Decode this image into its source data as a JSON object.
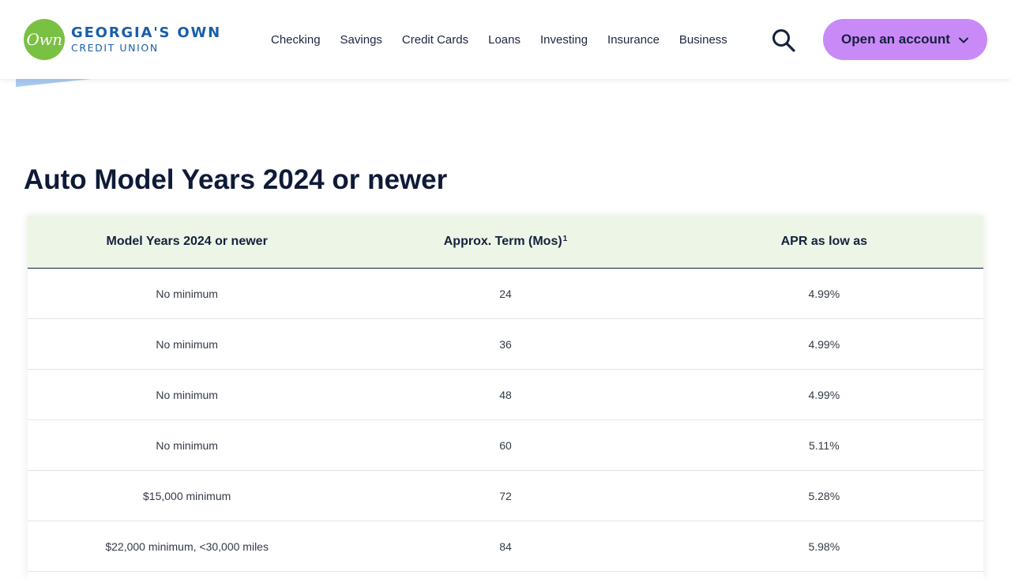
{
  "header": {
    "logo": {
      "mark": "Own",
      "line1": "GEORGIA'S OWN",
      "line2": "CREDIT UNION"
    },
    "nav": [
      "Checking",
      "Savings",
      "Credit Cards",
      "Loans",
      "Investing",
      "Insurance",
      "Business"
    ],
    "search_icon": "search-icon",
    "cta": {
      "label": "Open an account",
      "icon": "chevron-down-icon",
      "color": "#c98af7"
    }
  },
  "page": {
    "title": "Auto Model Years 2024 or newer"
  },
  "table": {
    "headers": [
      "Model Years 2024 or newer",
      "Approx. Term (Mos)",
      "APR as low as"
    ],
    "term_footnote": "1",
    "rows": [
      [
        "No minimum",
        "24",
        "4.99%"
      ],
      [
        "No minimum",
        "36",
        "4.99%"
      ],
      [
        "No minimum",
        "48",
        "4.99%"
      ],
      [
        "No minimum",
        "60",
        "5.11%"
      ],
      [
        "$15,000 minimum",
        "72",
        "5.28%"
      ],
      [
        "$22,000 minimum, <30,000 miles",
        "84",
        "5.98%"
      ]
    ]
  },
  "colors": {
    "brand_green": "#7ac143",
    "brand_blue": "#1a5fa8",
    "header_row_bg": "#edf5e6",
    "text_dark": "#14213d"
  }
}
